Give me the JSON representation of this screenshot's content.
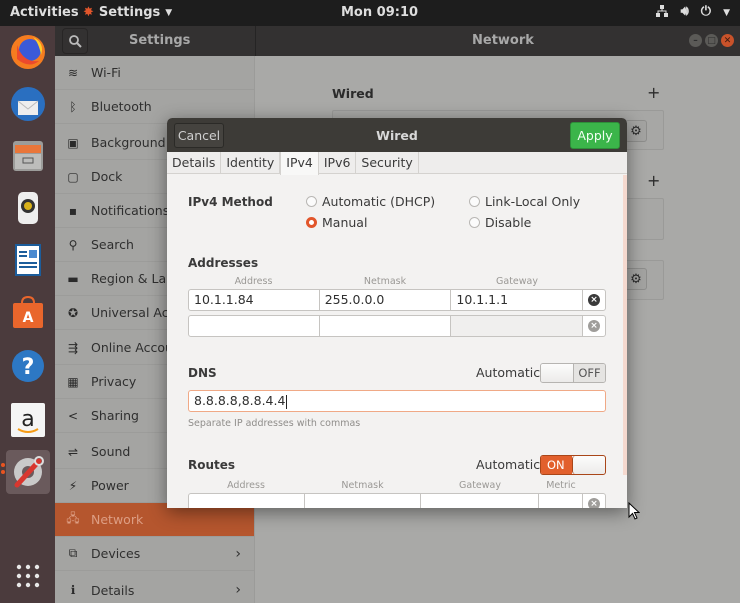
{
  "topbar": {
    "activities": "Activities",
    "app_name": "Settings",
    "clock": "Mon 09:10",
    "tray_icons": [
      "network-wired-icon",
      "volume-icon",
      "power-icon",
      "chevron-down-icon"
    ]
  },
  "dock": {
    "items": [
      {
        "name": "firefox",
        "icon": "firefox-icon"
      },
      {
        "name": "thunderbird",
        "icon": "thunderbird-icon"
      },
      {
        "name": "files",
        "icon": "files-icon"
      },
      {
        "name": "rhythmbox",
        "icon": "rhythmbox-icon"
      },
      {
        "name": "libreoffice-writer",
        "icon": "writer-icon"
      },
      {
        "name": "ubuntu-software",
        "icon": "software-icon"
      },
      {
        "name": "help",
        "icon": "help-icon"
      },
      {
        "name": "amazon",
        "icon": "amazon-icon"
      },
      {
        "name": "settings",
        "icon": "settings-icon",
        "active": true
      }
    ],
    "show_apps_icon": "app-grid-icon"
  },
  "settings_window": {
    "sidebar_title": "Settings",
    "panel_title": "Network",
    "sidebar": [
      {
        "label": "Wi-Fi",
        "icon": "wifi-icon"
      },
      {
        "label": "Bluetooth",
        "icon": "bluetooth-icon"
      },
      {
        "label": "Background",
        "icon": "background-icon"
      },
      {
        "label": "Dock",
        "icon": "dock-icon"
      },
      {
        "label": "Notifications",
        "icon": "notifications-icon"
      },
      {
        "label": "Search",
        "icon": "search-icon"
      },
      {
        "label": "Region & Language",
        "icon": "region-icon"
      },
      {
        "label": "Universal Access",
        "icon": "accessibility-icon"
      },
      {
        "label": "Online Accounts",
        "icon": "online-accounts-icon"
      },
      {
        "label": "Privacy",
        "icon": "privacy-icon"
      },
      {
        "label": "Sharing",
        "icon": "sharing-icon"
      },
      {
        "label": "Sound",
        "icon": "sound-icon"
      },
      {
        "label": "Power",
        "icon": "power-icon"
      },
      {
        "label": "Network",
        "icon": "network-icon",
        "selected": true
      },
      {
        "label": "Devices",
        "icon": "devices-icon",
        "has_submenu": true
      },
      {
        "label": "Details",
        "icon": "details-icon",
        "has_submenu": true
      }
    ],
    "content": {
      "wired_section_title": "Wired",
      "add_symbol": "+"
    }
  },
  "dialog": {
    "title": "Wired",
    "cancel_label": "Cancel",
    "apply_label": "Apply",
    "tabs": [
      "Details",
      "Identity",
      "IPv4",
      "IPv6",
      "Security"
    ],
    "active_tab": "IPv4",
    "ipv4_method": {
      "label": "IPv4 Method",
      "options": [
        "Automatic (DHCP)",
        "Manual",
        "Link-Local Only",
        "Disable"
      ],
      "selected": "Manual"
    },
    "addresses": {
      "label": "Addresses",
      "columns": [
        "Address",
        "Netmask",
        "Gateway"
      ],
      "rows": [
        [
          "10.1.1.84",
          "255.0.0.0",
          "10.1.1.1"
        ],
        [
          "",
          "",
          ""
        ]
      ]
    },
    "dns": {
      "label": "DNS",
      "automatic_label": "Automatic",
      "automatic_state": "OFF",
      "value": "8.8.8.8,8.8.4.4",
      "hint": "Separate IP addresses with commas"
    },
    "routes": {
      "label": "Routes",
      "automatic_label": "Automatic",
      "automatic_state": "ON",
      "columns": [
        "Address",
        "Netmask",
        "Gateway",
        "Metric"
      ]
    }
  },
  "colors": {
    "accent": "#e95420",
    "apply_green": "#3bb54a",
    "selected_sidebar": "#b5562e"
  }
}
